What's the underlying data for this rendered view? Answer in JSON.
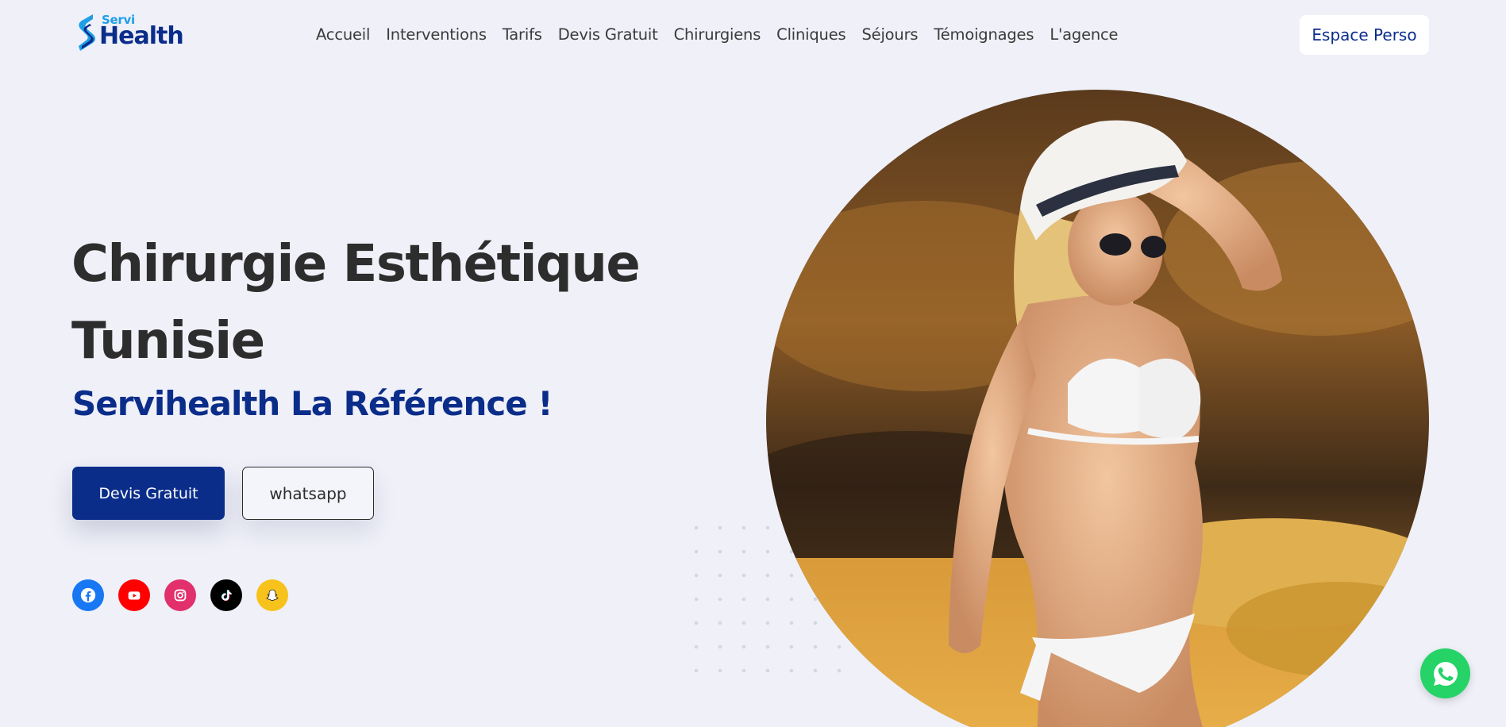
{
  "brand": {
    "logo_small": "Servi",
    "logo_big": "Health",
    "icon": "servihealth-s-logo-icon",
    "colors": {
      "primary": "#0b2d8a",
      "accent": "#1f9ee8",
      "background": "#eff0f8"
    }
  },
  "nav": {
    "items": [
      {
        "label": "Accueil"
      },
      {
        "label": "Interventions"
      },
      {
        "label": "Tarifs"
      },
      {
        "label": "Devis Gratuit"
      },
      {
        "label": "Chirurgiens"
      },
      {
        "label": "Cliniques"
      },
      {
        "label": "Séjours"
      },
      {
        "label": "Témoignages"
      },
      {
        "label": "L'agence"
      }
    ],
    "account_button": "Espace Perso"
  },
  "hero": {
    "title_line1": "Chirurgie Esthétique",
    "title_line2": "Tunisie",
    "subtitle": "Servihealth La Référence !",
    "primary_button": "Devis Gratuit",
    "secondary_button": "whatsapp",
    "photo": "woman-in-white-bikini-and-hat-on-beach-photo"
  },
  "socials": [
    {
      "name": "facebook-icon",
      "color": "#1877f2"
    },
    {
      "name": "youtube-icon",
      "color": "#ff0000"
    },
    {
      "name": "instagram-icon",
      "color": "#e1306c"
    },
    {
      "name": "tiktok-icon",
      "color": "#000000"
    },
    {
      "name": "snapchat-icon",
      "color": "#fffc00"
    }
  ],
  "floating": {
    "icon": "whatsapp-icon",
    "color": "#25d366"
  }
}
